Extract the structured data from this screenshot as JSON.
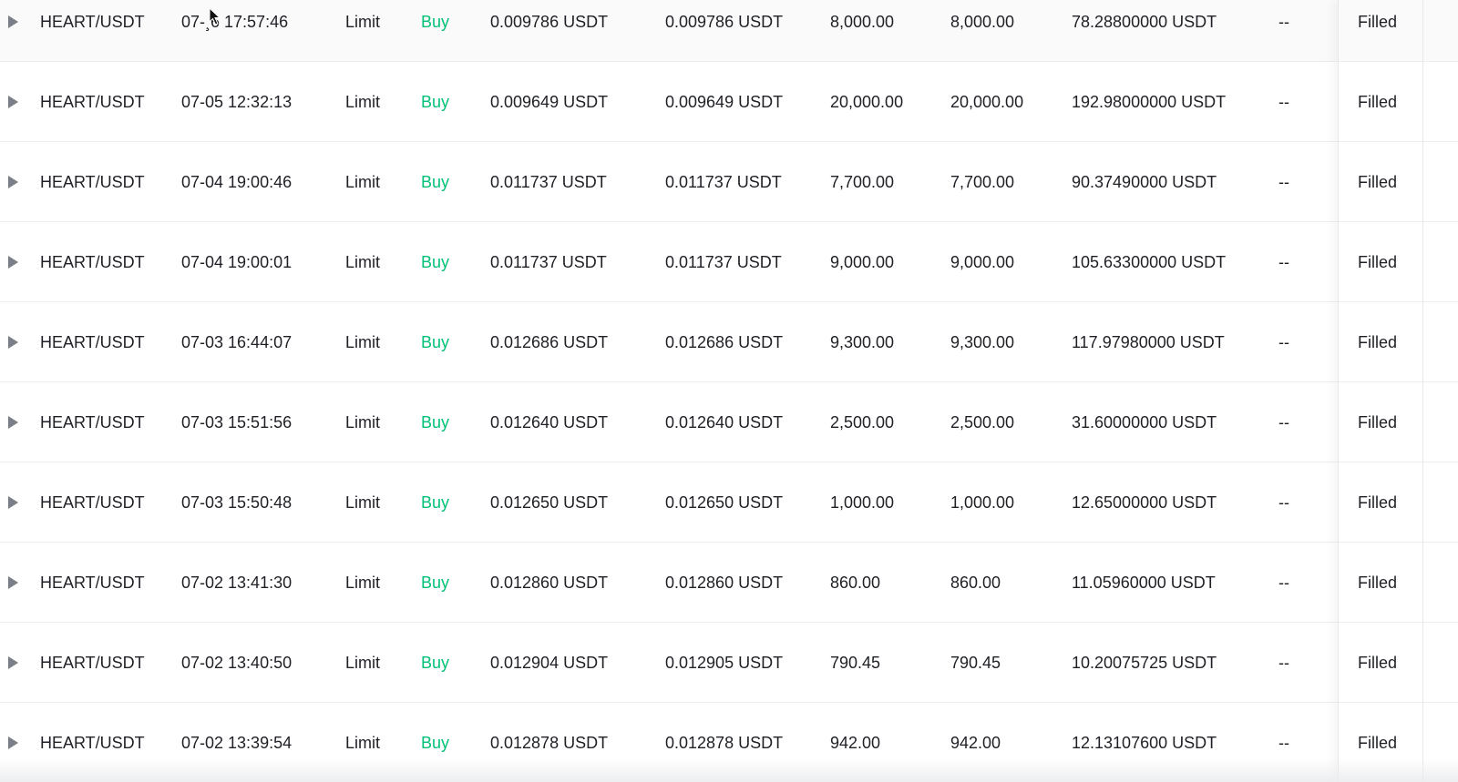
{
  "colors": {
    "buy": "#02c076",
    "text": "#1e2026",
    "divider": "#eceef1"
  },
  "icons": {
    "expand": "triangle-right-icon",
    "cursor": "mouse-pointer-icon"
  },
  "rows": [
    {
      "pair": "HEART/USDT",
      "time": "07-¸6 17:57:46",
      "type": "Limit",
      "side": "Buy",
      "price": "0.009786 USDT",
      "avg": "0.009786 USDT",
      "amount": "8,000.00",
      "filled": "8,000.00",
      "total": "78.28800000 USDT",
      "trigger": "--",
      "status": "Filled"
    },
    {
      "pair": "HEART/USDT",
      "time": "07-05 12:32:13",
      "type": "Limit",
      "side": "Buy",
      "price": "0.009649 USDT",
      "avg": "0.009649 USDT",
      "amount": "20,000.00",
      "filled": "20,000.00",
      "total": "192.98000000 USDT",
      "trigger": "--",
      "status": "Filled"
    },
    {
      "pair": "HEART/USDT",
      "time": "07-04 19:00:46",
      "type": "Limit",
      "side": "Buy",
      "price": "0.011737 USDT",
      "avg": "0.011737 USDT",
      "amount": "7,700.00",
      "filled": "7,700.00",
      "total": "90.37490000 USDT",
      "trigger": "--",
      "status": "Filled"
    },
    {
      "pair": "HEART/USDT",
      "time": "07-04 19:00:01",
      "type": "Limit",
      "side": "Buy",
      "price": "0.011737 USDT",
      "avg": "0.011737 USDT",
      "amount": "9,000.00",
      "filled": "9,000.00",
      "total": "105.63300000 USDT",
      "trigger": "--",
      "status": "Filled"
    },
    {
      "pair": "HEART/USDT",
      "time": "07-03 16:44:07",
      "type": "Limit",
      "side": "Buy",
      "price": "0.012686 USDT",
      "avg": "0.012686 USDT",
      "amount": "9,300.00",
      "filled": "9,300.00",
      "total": "117.97980000 USDT",
      "trigger": "--",
      "status": "Filled"
    },
    {
      "pair": "HEART/USDT",
      "time": "07-03 15:51:56",
      "type": "Limit",
      "side": "Buy",
      "price": "0.012640 USDT",
      "avg": "0.012640 USDT",
      "amount": "2,500.00",
      "filled": "2,500.00",
      "total": "31.60000000 USDT",
      "trigger": "--",
      "status": "Filled"
    },
    {
      "pair": "HEART/USDT",
      "time": "07-03 15:50:48",
      "type": "Limit",
      "side": "Buy",
      "price": "0.012650 USDT",
      "avg": "0.012650 USDT",
      "amount": "1,000.00",
      "filled": "1,000.00",
      "total": "12.65000000 USDT",
      "trigger": "--",
      "status": "Filled"
    },
    {
      "pair": "HEART/USDT",
      "time": "07-02 13:41:30",
      "type": "Limit",
      "side": "Buy",
      "price": "0.012860 USDT",
      "avg": "0.012860 USDT",
      "amount": "860.00",
      "filled": "860.00",
      "total": "11.05960000 USDT",
      "trigger": "--",
      "status": "Filled"
    },
    {
      "pair": "HEART/USDT",
      "time": "07-02 13:40:50",
      "type": "Limit",
      "side": "Buy",
      "price": "0.012904 USDT",
      "avg": "0.012905 USDT",
      "amount": "790.45",
      "filled": "790.45",
      "total": "10.20075725 USDT",
      "trigger": "--",
      "status": "Filled"
    },
    {
      "pair": "HEART/USDT",
      "time": "07-02 13:39:54",
      "type": "Limit",
      "side": "Buy",
      "price": "0.012878 USDT",
      "avg": "0.012878 USDT",
      "amount": "942.00",
      "filled": "942.00",
      "total": "12.13107600 USDT",
      "trigger": "--",
      "status": "Filled"
    }
  ]
}
